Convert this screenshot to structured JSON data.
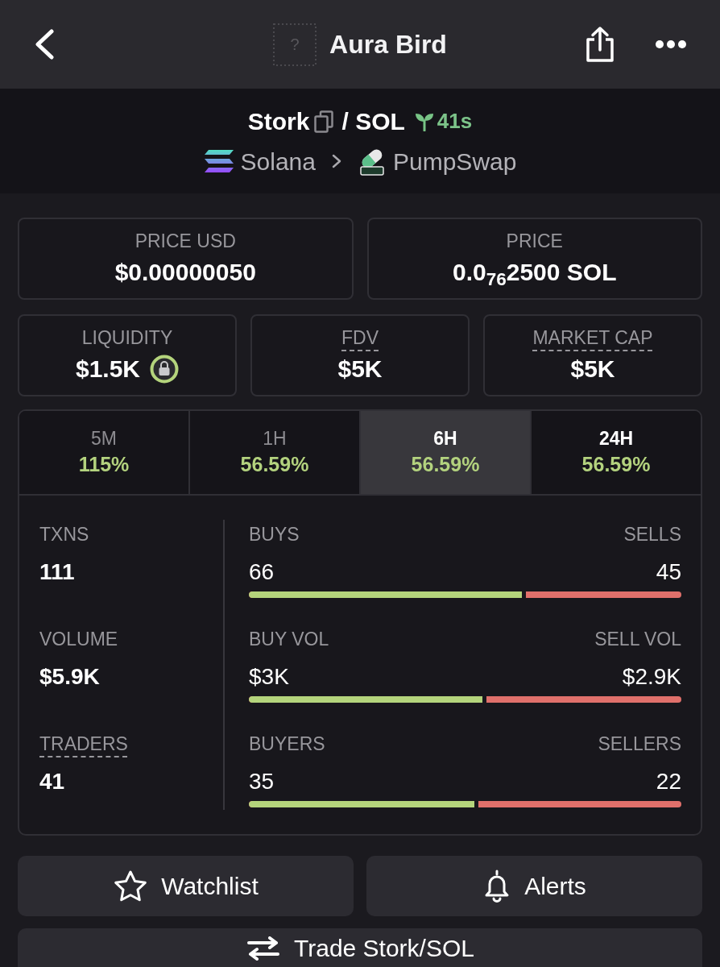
{
  "top_bar": {
    "logo_placeholder": "?",
    "title": "Aura Bird"
  },
  "pair": {
    "base": "Stork",
    "quote": "/ SOL",
    "age": "41s",
    "chain": "Solana",
    "dex": "PumpSwap"
  },
  "price_cards": [
    {
      "label": "PRICE USD",
      "value": "$0.00000050"
    },
    {
      "label": "PRICE",
      "value": "0.0$_{76}$2500 SOL"
    }
  ],
  "metric_cards": [
    {
      "label": "LIQUIDITY",
      "value": "$1.5K",
      "locked": true,
      "has_tooltip": false
    },
    {
      "label": "FDV",
      "value": "$5K",
      "locked": false,
      "has_tooltip": true
    },
    {
      "label": "MARKET CAP",
      "value": "$5K",
      "locked": false,
      "has_tooltip": true
    }
  ],
  "timeframes": [
    {
      "label": "5M",
      "change": "115%",
      "selected": false,
      "dimmed": true
    },
    {
      "label": "1H",
      "change": "56.59%",
      "selected": false,
      "dimmed": true
    },
    {
      "label": "6H",
      "change": "56.59%",
      "selected": true,
      "dimmed": false
    },
    {
      "label": "24H",
      "change": "56.59%",
      "selected": false,
      "dimmed": false
    }
  ],
  "stats": [
    {
      "label": "TXNS",
      "value": "111",
      "has_tooltip": false
    },
    {
      "label": "VOLUME",
      "value": "$5.9K",
      "has_tooltip": false
    },
    {
      "label": "TRADERS",
      "value": "41",
      "has_tooltip": true
    }
  ],
  "splits": [
    {
      "buy_label": "BUYS",
      "sell_label": "SELLS",
      "buy_value": "66",
      "sell_value": "45",
      "level": 0.64
    },
    {
      "buy_label": "BUY VOL",
      "sell_label": "SELL VOL",
      "buy_value": "$3K",
      "sell_value": "$2.9K",
      "level": 0.55
    },
    {
      "buy_label": "BUYERS",
      "sell_label": "SELLERS",
      "buy_value": "35",
      "sell_value": "22",
      "level": 0.53
    }
  ],
  "actions": [
    {
      "kind": "watchlist",
      "label": "Watchlist"
    },
    {
      "kind": "alerts",
      "label": "Alerts"
    }
  ],
  "trade_button": {
    "label": "Trade Stork/SOL"
  }
}
